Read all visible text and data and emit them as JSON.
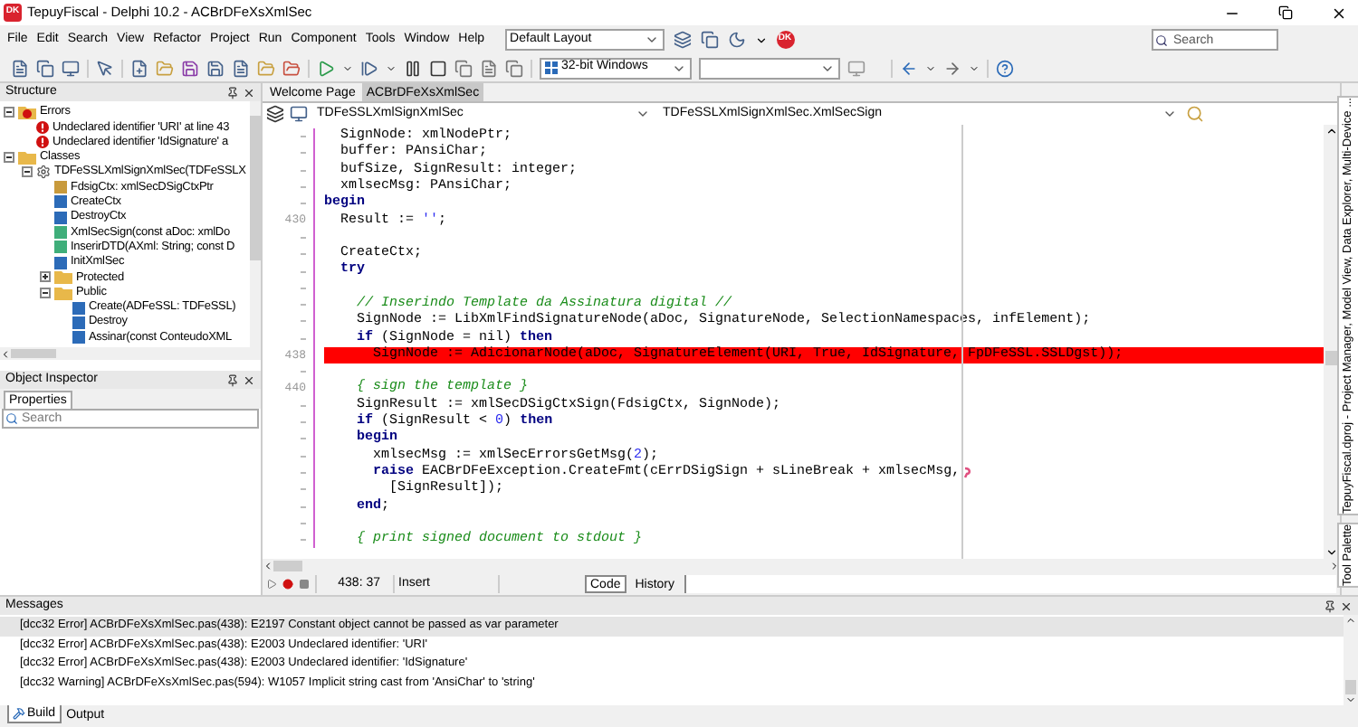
{
  "window": {
    "title": "TepuyFiscal - Delphi 10.2 - ACBrDFeXsXmlSec",
    "logo_text": "DK"
  },
  "menu": [
    "File",
    "Edit",
    "Search",
    "View",
    "Refactor",
    "Project",
    "Run",
    "Component",
    "Tools",
    "Window",
    "Help"
  ],
  "layout_dropdown": {
    "value": "Default Layout"
  },
  "badge_text": "DK",
  "search": {
    "placeholder": "Search"
  },
  "platform_dropdown": {
    "value": "32-bit Windows"
  },
  "structure": {
    "title": "Structure",
    "tree": [
      {
        "label": "Errors",
        "kind": "error_group",
        "expanded": true,
        "children": [
          {
            "label": "Undeclared identifier 'URI' at line 43",
            "kind": "error"
          },
          {
            "label": "Undeclared identifier 'IdSignature' a",
            "kind": "error"
          }
        ]
      },
      {
        "label": "Classes",
        "kind": "folder",
        "expanded": true,
        "children": [
          {
            "label": "TDFeSSLXmlSignXmlSec(TDFeSSLX",
            "kind": "class",
            "expanded": true,
            "children": [
              {
                "label": "FdsigCtx: xmlSecDSigCtxPtr",
                "kind": "field"
              },
              {
                "label": "CreateCtx",
                "kind": "procedure"
              },
              {
                "label": "DestroyCtx",
                "kind": "procedure"
              },
              {
                "label": "XmlSecSign(const aDoc: xmlDo",
                "kind": "function"
              },
              {
                "label": "InserirDTD(AXml: String; const D",
                "kind": "function"
              },
              {
                "label": "InitXmlSec",
                "kind": "procedure"
              },
              {
                "label": "Protected",
                "kind": "folder",
                "expanded": false
              },
              {
                "label": "Public",
                "kind": "folder",
                "expanded": true,
                "children": [
                  {
                    "label": "Create(ADFeSSL: TDFeSSL)",
                    "kind": "procedure"
                  },
                  {
                    "label": "Destroy",
                    "kind": "procedure"
                  },
                  {
                    "label": "Assinar(const ConteudoXML",
                    "kind": "procedure"
                  }
                ]
              }
            ]
          }
        ]
      }
    ]
  },
  "object_inspector": {
    "title": "Object Inspector",
    "tabs": [
      {
        "label": "Properties",
        "selected": true
      }
    ],
    "search": {
      "placeholder": "Search"
    }
  },
  "editor": {
    "tabs": [
      {
        "label": "Welcome Page",
        "selected": false
      },
      {
        "label": "ACBrDFeXsXmlSec",
        "selected": true
      }
    ],
    "class_dropdown": "TDFeSSLXmlSignXmlSec",
    "method_dropdown": "TDFeSSLXmlSignXmlSec.XmlSecSign",
    "lines": [
      {
        "highlighted": false,
        "tokens": [
          {
            "kind": "plain",
            "text": "  SignNode: xmlNodePtr;"
          }
        ]
      },
      {
        "highlighted": false,
        "tokens": [
          {
            "kind": "plain",
            "text": "  buffer: PAnsiChar;"
          }
        ]
      },
      {
        "highlighted": false,
        "tokens": [
          {
            "kind": "plain",
            "text": "  bufSize, SignResult: integer;"
          }
        ]
      },
      {
        "highlighted": false,
        "tokens": [
          {
            "kind": "plain",
            "text": "  xmlsecMsg: PAnsiChar;"
          }
        ]
      },
      {
        "highlighted": false,
        "tokens": [
          {
            "kind": "keyword",
            "text": "begin"
          }
        ]
      },
      {
        "highlighted": false,
        "number": "430",
        "tokens": [
          {
            "kind": "plain",
            "text": "  Result := "
          },
          {
            "kind": "string",
            "text": "''"
          },
          {
            "kind": "plain",
            "text": ";"
          }
        ]
      },
      {
        "highlighted": false
      },
      {
        "highlighted": false,
        "tokens": [
          {
            "kind": "plain",
            "text": "  CreateCtx;"
          }
        ]
      },
      {
        "highlighted": false,
        "tokens": [
          {
            "kind": "keyword",
            "text": "  try"
          }
        ]
      },
      {
        "highlighted": false
      },
      {
        "highlighted": false,
        "tokens": [
          {
            "kind": "comment",
            "text": "    // Inserindo Template da Assinatura digital //"
          }
        ]
      },
      {
        "highlighted": false,
        "tokens": [
          {
            "kind": "plain",
            "text": "    SignNode := LibXmlFindSignatureNode(aDoc, SignatureNode, SelectionNamespaces, infElement);"
          }
        ]
      },
      {
        "highlighted": false,
        "tokens": [
          {
            "kind": "keyword",
            "text": "    if"
          },
          {
            "kind": "plain",
            "text": " (SignNode = nil) "
          },
          {
            "kind": "keyword",
            "text": "then"
          }
        ]
      },
      {
        "highlighted": true,
        "number": "438",
        "tokens": [
          {
            "kind": "plain",
            "text": "      SignNode := AdicionarNode(aDoc, SignatureElement(URI, True, IdSignature, FpDFeSSL.SSLDgst));"
          }
        ]
      },
      {
        "highlighted": false
      },
      {
        "highlighted": false,
        "number": "440",
        "tokens": [
          {
            "kind": "comment",
            "text": "    { sign the template }"
          }
        ]
      },
      {
        "highlighted": false,
        "tokens": [
          {
            "kind": "plain",
            "text": "    SignResult := xmlSecDSigCtxSign(FdsigCtx, SignNode);"
          }
        ]
      },
      {
        "highlighted": false,
        "tokens": [
          {
            "kind": "keyword",
            "text": "    if"
          },
          {
            "kind": "plain",
            "text": " (SignResult < "
          },
          {
            "kind": "number",
            "text": "0"
          },
          {
            "kind": "plain",
            "text": ") "
          },
          {
            "kind": "keyword",
            "text": "then"
          }
        ]
      },
      {
        "highlighted": false,
        "tokens": [
          {
            "kind": "keyword",
            "text": "    begin"
          }
        ]
      },
      {
        "highlighted": false,
        "tokens": [
          {
            "kind": "plain",
            "text": "      xmlsecMsg := xmlSecErrorsGetMsg("
          },
          {
            "kind": "number",
            "text": "2"
          },
          {
            "kind": "plain",
            "text": ");"
          }
        ]
      },
      {
        "highlighted": false,
        "tokens": [
          {
            "kind": "keyword",
            "text": "      raise"
          },
          {
            "kind": "plain",
            "text": " EACBrDFeException.CreateFmt(cErrDSigSign + sLineBreak + xmlsecMsg,"
          },
          {
            "kind": "wrap_mark"
          }
        ]
      },
      {
        "highlighted": false,
        "tokens": [
          {
            "kind": "plain",
            "text": "        [SignResult]);"
          }
        ]
      },
      {
        "highlighted": false,
        "tokens": [
          {
            "kind": "keyword",
            "text": "    end"
          },
          {
            "kind": "plain",
            "text": ";"
          }
        ]
      },
      {
        "highlighted": false
      },
      {
        "highlighted": false,
        "tokens": [
          {
            "kind": "comment",
            "text": "    { print signed document to stdout }"
          }
        ]
      }
    ],
    "status": {
      "position": "438: 37",
      "mode": "Insert"
    },
    "view_tabs": [
      {
        "label": "Code",
        "selected": true
      },
      {
        "label": "History",
        "selected": false
      }
    ]
  },
  "side_tabs": [
    "Tool Palette",
    "TepuyFiscal.dproj - Project Manager, Model View, Data Explorer, Multi-Device ..."
  ],
  "messages": {
    "title": "Messages",
    "rows": [
      {
        "text": "[dcc32 Error] ACBrDFeXsXmlSec.pas(438): E2197 Constant object cannot be passed as var parameter",
        "selected": true
      },
      {
        "text": "[dcc32 Error] ACBrDFeXsXmlSec.pas(438): E2003 Undeclared identifier: 'URI'",
        "selected": false
      },
      {
        "text": "[dcc32 Error] ACBrDFeXsXmlSec.pas(438): E2003 Undeclared identifier: 'IdSignature'",
        "selected": false
      },
      {
        "text": "[dcc32 Warning] ACBrDFeXsXmlSec.pas(594): W1057 Implicit string cast from 'AnsiChar' to 'string'",
        "selected": false
      }
    ]
  },
  "bottom_tabs": [
    {
      "label": "Build",
      "selected": true
    },
    {
      "label": "Output",
      "selected": false
    }
  ]
}
